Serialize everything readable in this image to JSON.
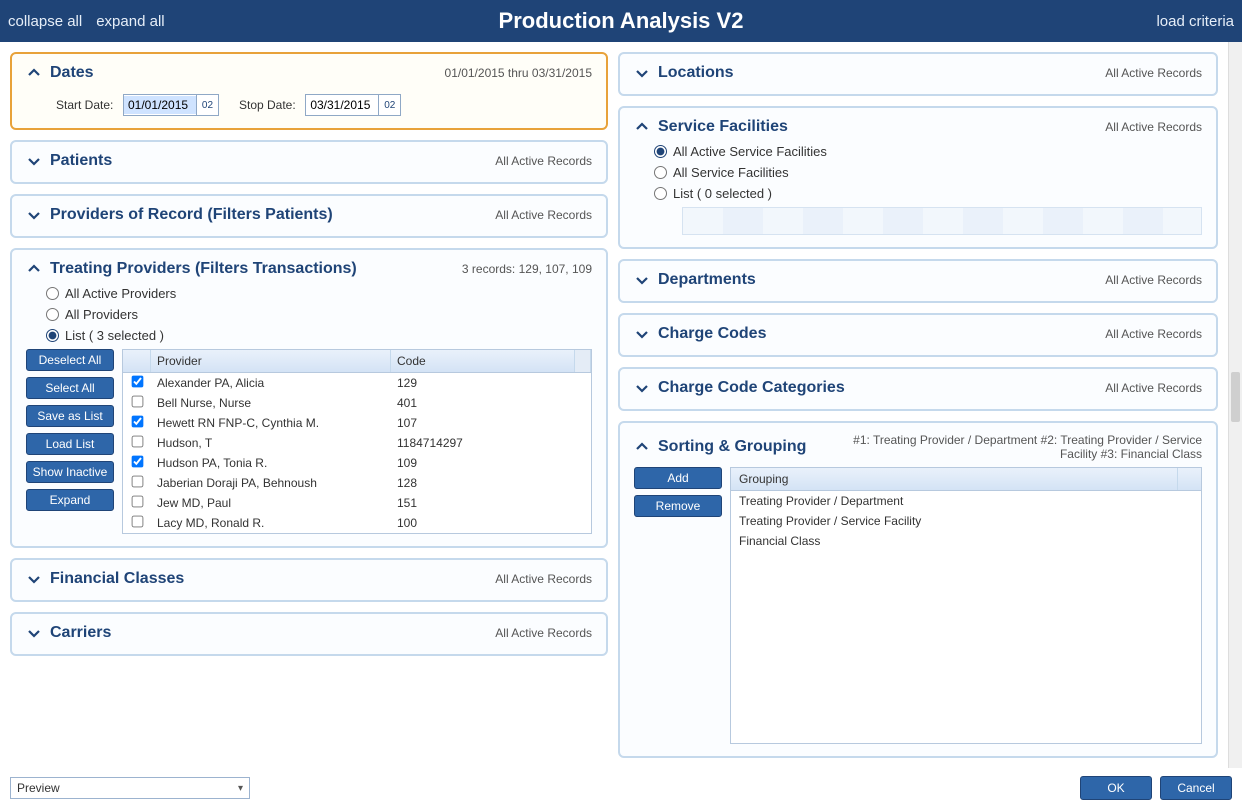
{
  "header": {
    "title": "Production Analysis V2",
    "collapse_all": "collapse all",
    "expand_all": "expand all",
    "load_criteria": "load criteria"
  },
  "panels": {
    "dates": {
      "title": "Dates",
      "summary": "01/01/2015 thru 03/31/2015",
      "start_label": "Start Date:",
      "stop_label": "Stop Date:",
      "start_value": "01/01/2015",
      "stop_value": "03/31/2015",
      "cal_glyph": "02"
    },
    "patients": {
      "title": "Patients",
      "summary": "All Active Records"
    },
    "providers_record": {
      "title": "Providers of Record (Filters Patients)",
      "summary": "All Active Records"
    },
    "treating_providers": {
      "title": "Treating Providers (Filters Transactions)",
      "summary": "3 records: 129, 107, 109",
      "radio_all_active": "All Active Providers",
      "radio_all": "All Providers",
      "radio_list": "List  ( 3 selected )",
      "buttons": {
        "deselect_all": "Deselect All",
        "select_all": "Select All",
        "save_as_list": "Save as List",
        "load_list": "Load List",
        "show_inactive": "Show Inactive",
        "expand": "Expand"
      },
      "columns": {
        "provider": "Provider",
        "code": "Code"
      },
      "rows": [
        {
          "checked": true,
          "name": "Alexander PA, Alicia",
          "code": "129"
        },
        {
          "checked": false,
          "name": "Bell Nurse, Nurse",
          "code": "401"
        },
        {
          "checked": true,
          "name": "Hewett RN FNP-C, Cynthia M.",
          "code": "107"
        },
        {
          "checked": false,
          "name": "Hudson, T",
          "code": "1184714297"
        },
        {
          "checked": true,
          "name": "Hudson PA, Tonia R.",
          "code": "109"
        },
        {
          "checked": false,
          "name": "Jaberian Doraji PA, Behnoush",
          "code": "128"
        },
        {
          "checked": false,
          "name": "Jew MD, Paul",
          "code": "151"
        },
        {
          "checked": false,
          "name": "Lacy MD, Ronald R.",
          "code": "100"
        }
      ]
    },
    "financial_classes": {
      "title": "Financial Classes",
      "summary": "All Active Records"
    },
    "carriers": {
      "title": "Carriers",
      "summary": "All Active Records"
    },
    "locations": {
      "title": "Locations",
      "summary": "All Active Records"
    },
    "service_facilities": {
      "title": "Service Facilities",
      "summary": "All Active Records",
      "radio_all_active": "All Active Service Facilities",
      "radio_all": "All Service Facilities",
      "radio_list": "List  ( 0 selected )"
    },
    "departments": {
      "title": "Departments",
      "summary": "All Active Records"
    },
    "charge_codes": {
      "title": "Charge Codes",
      "summary": "All Active Records"
    },
    "charge_code_categories": {
      "title": "Charge Code Categories",
      "summary": "All Active Records"
    },
    "sorting_grouping": {
      "title": "Sorting & Grouping",
      "summary": "#1: Treating Provider / Department  #2: Treating Provider / Service Facility  #3: Financial Class",
      "buttons": {
        "add": "Add",
        "remove": "Remove"
      },
      "column": "Grouping",
      "items": [
        "Treating Provider / Department",
        "Treating Provider / Service Facility",
        "Financial Class"
      ]
    }
  },
  "footer": {
    "dropdown_value": "Preview",
    "ok": "OK",
    "cancel": "Cancel"
  }
}
